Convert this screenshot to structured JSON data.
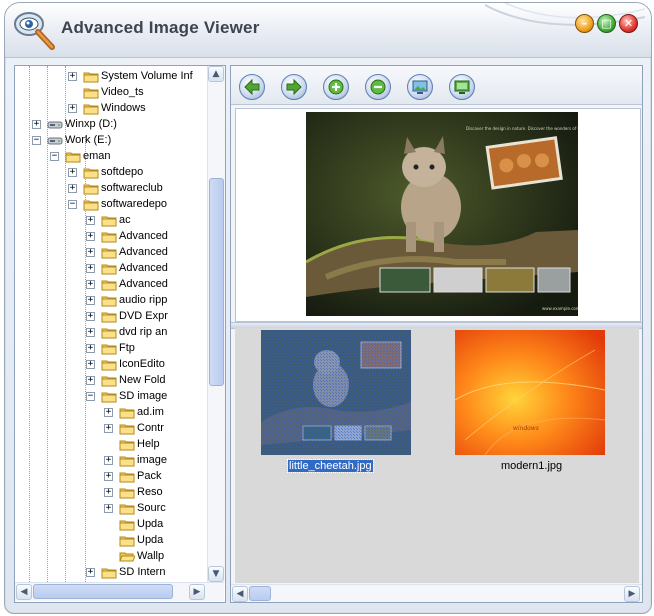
{
  "app": {
    "title": "Advanced Image Viewer",
    "logo_icon": "magnifier-eye-icon",
    "window_controls": {
      "minimize": "minimize-icon",
      "maximize": "maximize-icon",
      "close": "close-icon"
    }
  },
  "tree": {
    "items": [
      {
        "label": "System Volume Inf",
        "expander": "+",
        "icon": "folder-icon"
      },
      {
        "label": "Video_ts",
        "expander": "",
        "icon": "folder-icon"
      },
      {
        "label": "Windows",
        "expander": "+",
        "icon": "folder-icon"
      },
      {
        "label": "Winxp (D:)",
        "expander": "+",
        "icon": "drive-icon"
      },
      {
        "label": "Work (E:)",
        "expander": "−",
        "icon": "drive-icon"
      },
      {
        "label": "eman",
        "expander": "−",
        "icon": "folder-icon"
      },
      {
        "label": "softdepo",
        "expander": "+",
        "icon": "folder-icon"
      },
      {
        "label": "softwareclub",
        "expander": "+",
        "icon": "folder-icon"
      },
      {
        "label": "softwaredepo",
        "expander": "−",
        "icon": "folder-icon"
      },
      {
        "label": "ac",
        "expander": "+",
        "icon": "folder-icon"
      },
      {
        "label": "Advanced",
        "expander": "+",
        "icon": "folder-icon"
      },
      {
        "label": "Advanced",
        "expander": "+",
        "icon": "folder-icon"
      },
      {
        "label": "Advanced",
        "expander": "+",
        "icon": "folder-icon"
      },
      {
        "label": "Advanced",
        "expander": "+",
        "icon": "folder-icon"
      },
      {
        "label": "audio ripp",
        "expander": "+",
        "icon": "folder-icon"
      },
      {
        "label": "DVD Expr",
        "expander": "+",
        "icon": "folder-icon"
      },
      {
        "label": "dvd rip an",
        "expander": "+",
        "icon": "folder-icon"
      },
      {
        "label": "Ftp",
        "expander": "+",
        "icon": "folder-icon"
      },
      {
        "label": "IconEdito",
        "expander": "+",
        "icon": "folder-icon"
      },
      {
        "label": "New Fold",
        "expander": "+",
        "icon": "folder-icon"
      },
      {
        "label": "SD image",
        "expander": "−",
        "icon": "folder-icon"
      },
      {
        "label": "ad.im",
        "expander": "+",
        "icon": "folder-icon"
      },
      {
        "label": "Contr",
        "expander": "+",
        "icon": "folder-icon"
      },
      {
        "label": "Help",
        "expander": "",
        "icon": "folder-icon"
      },
      {
        "label": "image",
        "expander": "+",
        "icon": "folder-icon"
      },
      {
        "label": "Pack",
        "expander": "+",
        "icon": "folder-icon"
      },
      {
        "label": "Reso",
        "expander": "+",
        "icon": "folder-icon"
      },
      {
        "label": "Sourc",
        "expander": "+",
        "icon": "folder-icon"
      },
      {
        "label": "Upda",
        "expander": "",
        "icon": "folder-icon"
      },
      {
        "label": "Upda",
        "expander": "",
        "icon": "folder-icon"
      },
      {
        "label": "Wallp",
        "expander": "",
        "icon": "folder-open-icon"
      },
      {
        "label": "SD Intern",
        "expander": "+",
        "icon": "folder-icon"
      }
    ]
  },
  "toolbar": {
    "buttons": [
      {
        "name": "back-button",
        "icon": "arrow-left-icon"
      },
      {
        "name": "forward-button",
        "icon": "arrow-right-icon"
      },
      {
        "name": "zoom-in-button",
        "icon": "zoom-in-icon"
      },
      {
        "name": "zoom-out-button",
        "icon": "zoom-out-icon"
      },
      {
        "name": "wallpaper-button",
        "icon": "monitor-icon"
      },
      {
        "name": "fullscreen-button",
        "icon": "fullscreen-icon"
      }
    ]
  },
  "thumbnails": {
    "items": [
      {
        "filename": "little_cheetah.jpg",
        "selected": true
      },
      {
        "filename": "modern1.jpg",
        "selected": false
      }
    ]
  },
  "colors": {
    "selection": "#316ac5",
    "accent_green": "#3fae35",
    "close_red": "#e2382c"
  }
}
